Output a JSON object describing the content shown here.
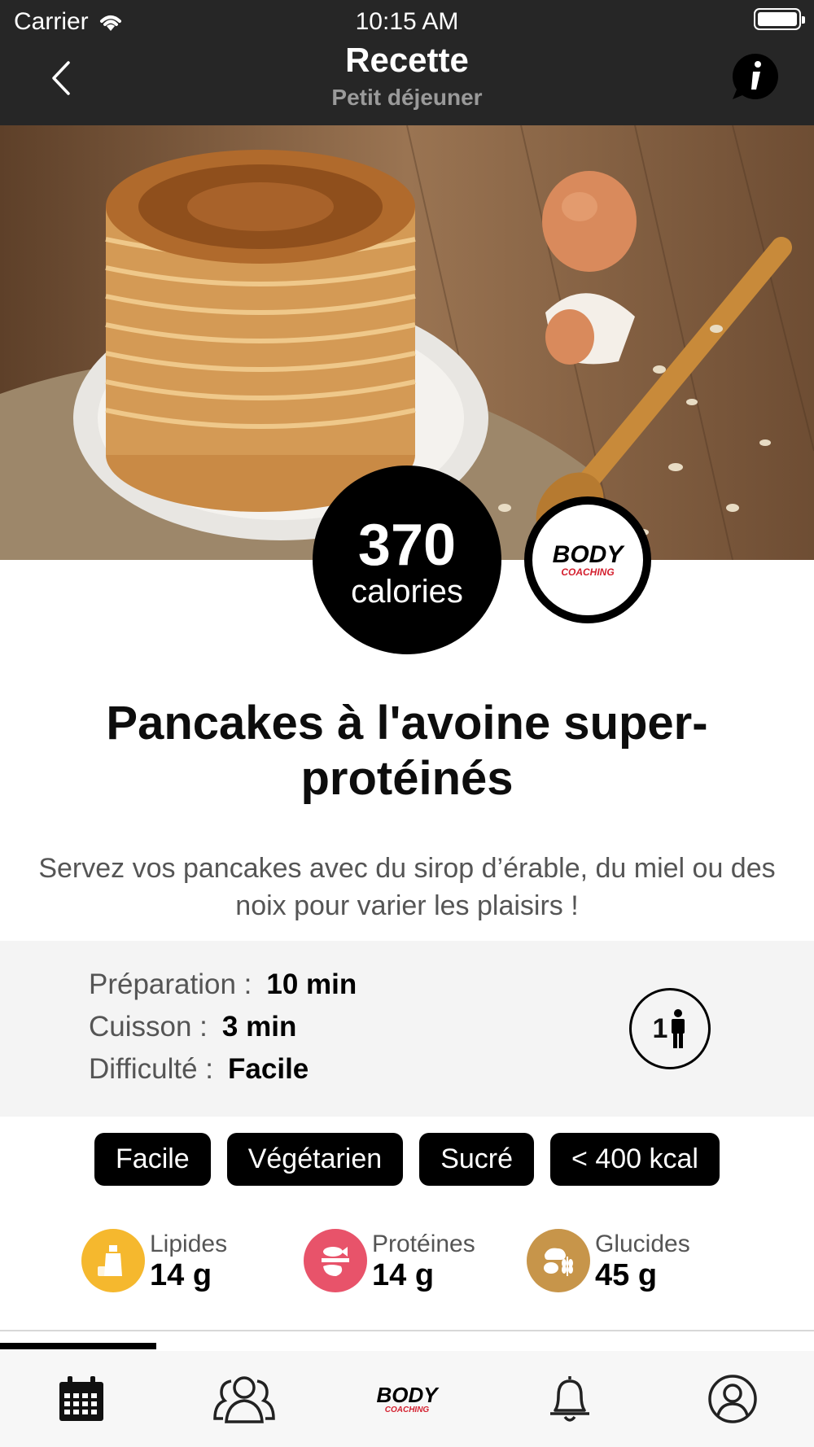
{
  "status_bar": {
    "carrier": "Carrier",
    "time": "10:15 AM"
  },
  "nav": {
    "title": "Recette",
    "subtitle": "Petit déjeuner",
    "back_icon": "chevron-left-icon",
    "info_icon": "info-bubble-icon"
  },
  "recipe": {
    "calories_value": "370",
    "calories_unit": "calories",
    "brand_logo_text": "BODY COACHING",
    "title": "Pancakes à l'avoine super-protéinés",
    "description": "Servez vos pancakes avec du sirop d’érable, du miel ou des noix pour varier les plaisirs !"
  },
  "info": {
    "preparation_label": "Préparation :",
    "preparation_value": "10 min",
    "cuisson_label": "Cuisson :",
    "cuisson_value": "3 min",
    "difficulte_label": "Difficulté :",
    "difficulte_value": "Facile",
    "servings": "1"
  },
  "tags": [
    "Facile",
    "Végétarien",
    "Sucré",
    "< 400 kcal"
  ],
  "macros": [
    {
      "label": "Lipides",
      "value": "14 g",
      "color": "#f5b82e",
      "icon": "oil-bottle-icon"
    },
    {
      "label": "Protéines",
      "value": "14 g",
      "color": "#e8536a",
      "icon": "fish-meat-icon"
    },
    {
      "label": "Glucides",
      "value": "45 g",
      "color": "#c7954a",
      "icon": "bread-grain-icon"
    }
  ],
  "tabbar": {
    "items": [
      "calendar-icon",
      "community-icon",
      "body-coaching-logo",
      "bell-icon",
      "profile-icon"
    ],
    "active": "calendar-icon"
  },
  "colors": {
    "topbar": "#262626",
    "accent": "#000000",
    "info_bg": "#f4f4f4"
  }
}
